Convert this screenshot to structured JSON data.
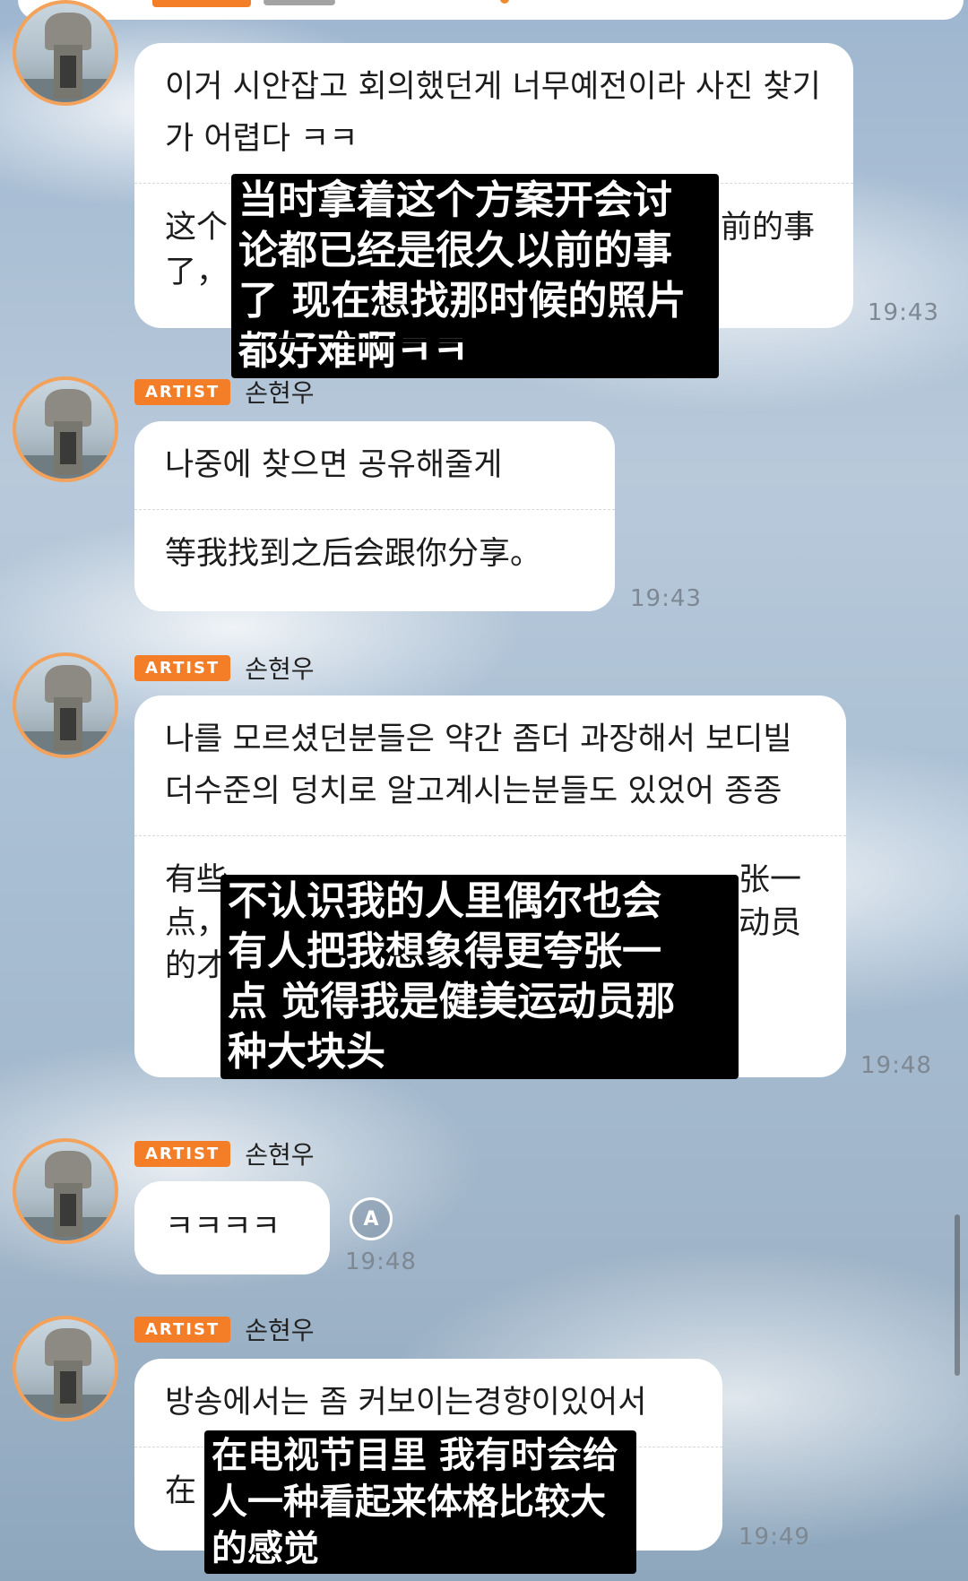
{
  "messages": [
    {
      "sender": "",
      "badge": "",
      "korean": "이거 시안잡고 회의했던게 너무예전이라 사진 찾기가 어렵다 ㅋㅋ",
      "translation_fragments": [
        "这个",
        "前的事",
        "了，"
      ],
      "time": "19:43",
      "overlay": "当时拿着这个方案开会讨\n论都已经是很久以前的事\n了 现在想找那时候的照片\n都好难啊ㅋㅋ"
    },
    {
      "sender": "손현우",
      "badge": "ARTIST",
      "korean": "나중에 찾으면 공유해줄게",
      "translation": "等我找到之后会跟你分享。",
      "time": "19:43"
    },
    {
      "sender": "손현우",
      "badge": "ARTIST",
      "korean": "나를 모르셨던분들은 약간 좀더 과장해서 보디빌더수준의 덩치로 알고계시는분들도 있었어 종종",
      "translation_fragments": [
        "有些",
        "张一",
        "点，",
        "动员",
        "的才"
      ],
      "time": "19:48",
      "overlay": "不认识我的人里偶尔也会\n有人把我想象得更夸张一\n点 觉得我是健美运动员那\n种大块头"
    },
    {
      "sender": "손현우",
      "badge": "ARTIST",
      "korean": "ㅋㅋㅋㅋ",
      "time": "19:48",
      "translate_icon": "translate-icon"
    },
    {
      "sender": "손현우",
      "badge": "ARTIST",
      "korean": "방송에서는 좀 커보이는경향이있어서",
      "translation_fragments": [
        "在"
      ],
      "time": "19:49",
      "overlay": "在电视节目里 我有时会给\n人一种看起来体格比较大\n的感觉"
    }
  ],
  "translate_icon_label": "A"
}
